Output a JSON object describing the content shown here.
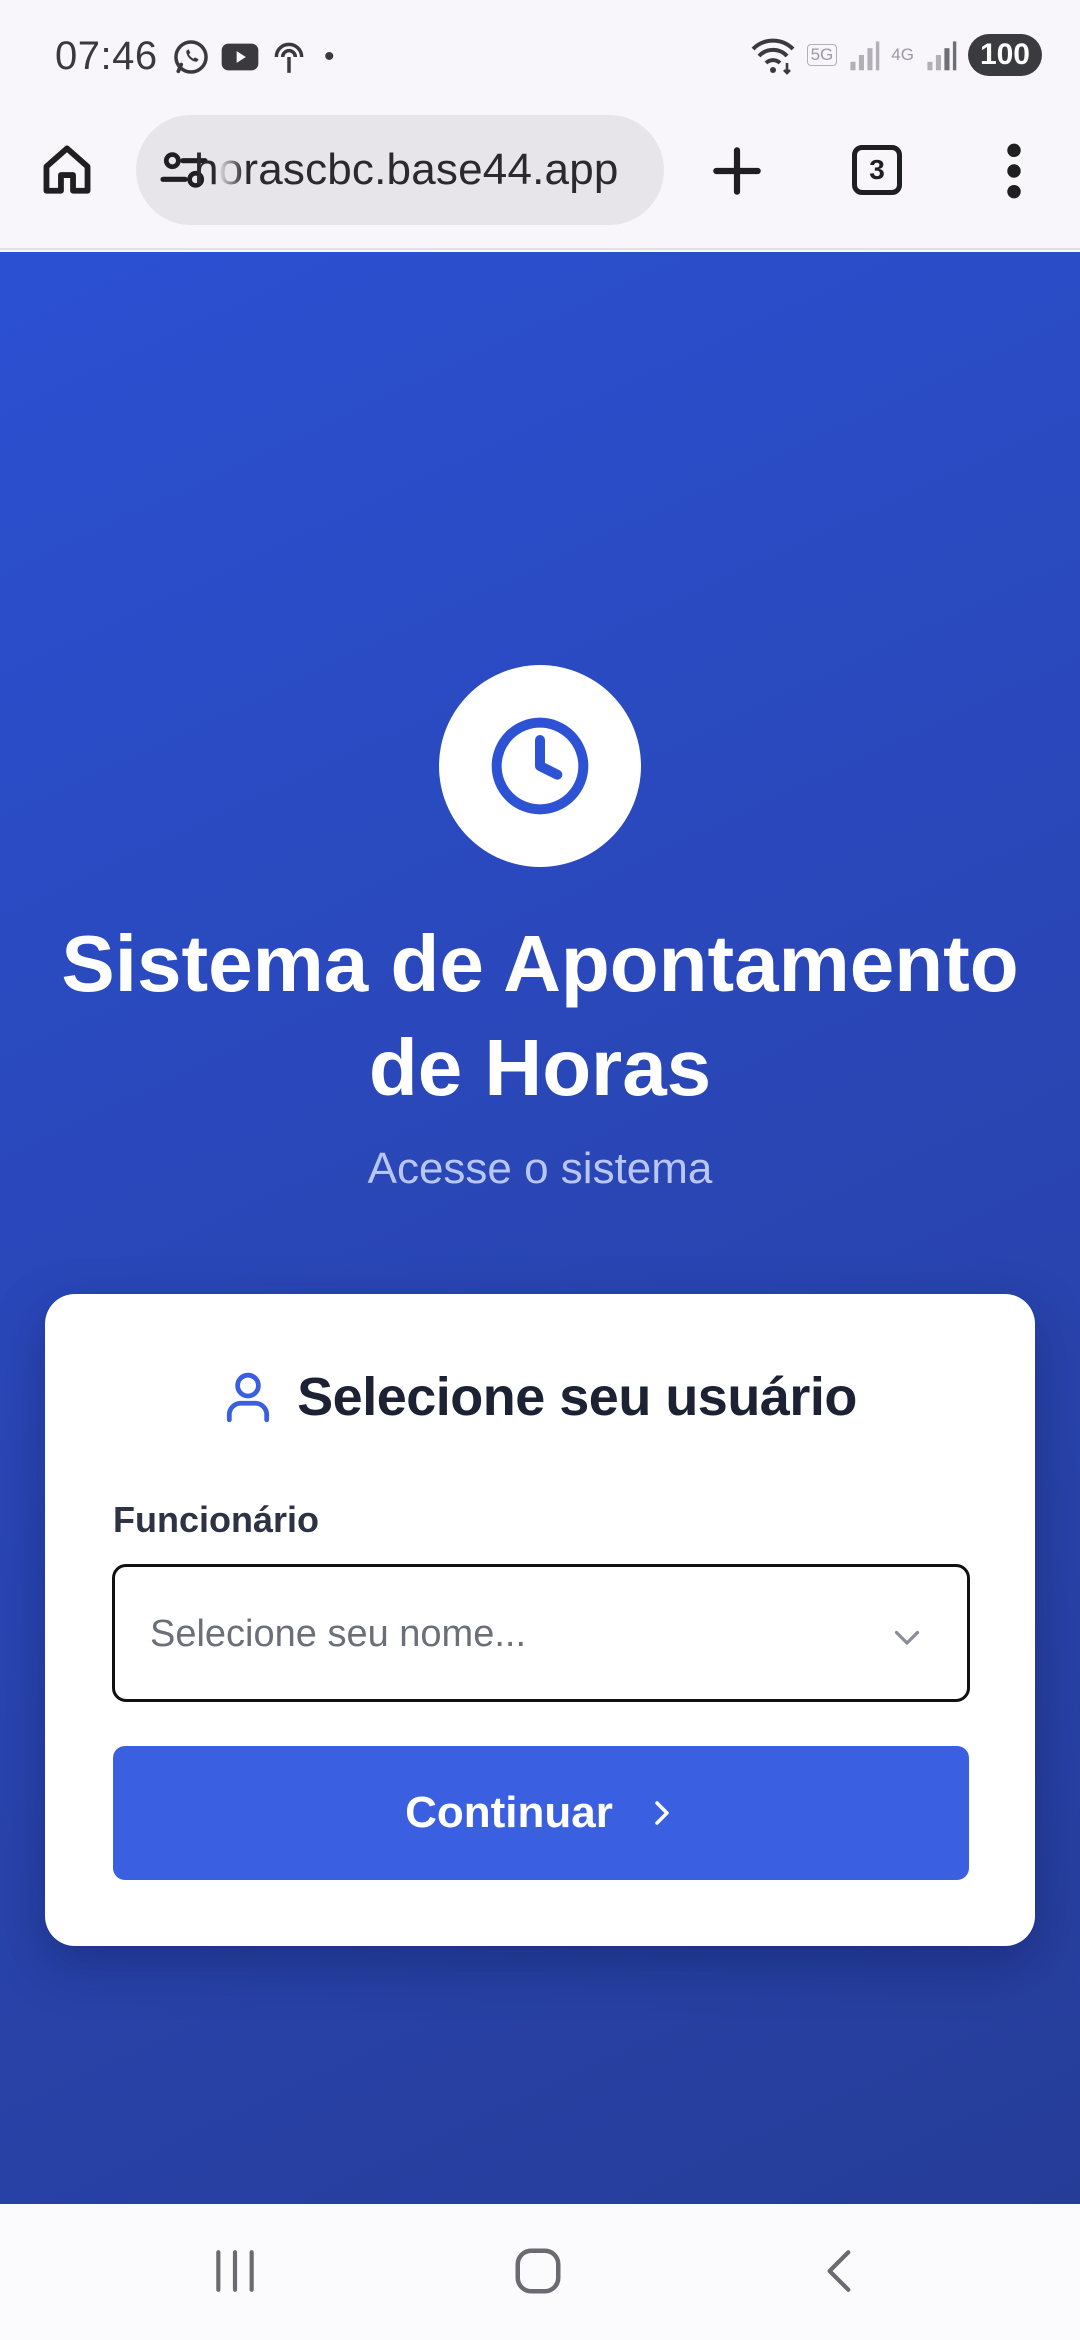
{
  "status_bar": {
    "time": "07:46",
    "app_icons": [
      "whatsapp-icon",
      "youtube-icon",
      "hotspot-icon"
    ],
    "dot": "•",
    "network_5g": "5G",
    "network_4g": "4G",
    "battery": "100"
  },
  "browser": {
    "url": "horascbc.base44.app",
    "tab_count": "3"
  },
  "page": {
    "title": "Sistema de Apontamento de Horas",
    "subtitle": "Acesse o sistema",
    "accent_color": "#3a5fe0",
    "background_color": "#2a47b8"
  },
  "login_card": {
    "title": "Selecione seu usuário",
    "field_label": "Funcionário",
    "select_placeholder": "Selecione seu nome...",
    "continue_label": "Continuar"
  }
}
